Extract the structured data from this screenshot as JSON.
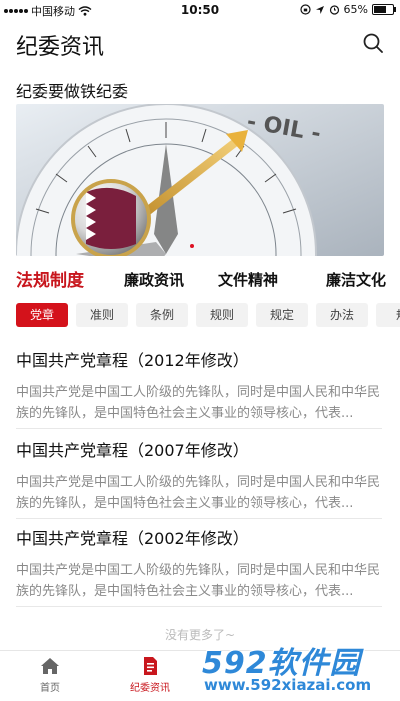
{
  "status_bar": {
    "carrier": "中国移动",
    "time": "10:50",
    "battery": "65%",
    "battery_level": 0.65
  },
  "header": {
    "title": "纪委资讯",
    "search_icon": "search-icon"
  },
  "section": {
    "title": "纪委要做铁纪委"
  },
  "categories": [
    {
      "label": "法规制度",
      "active": true
    },
    {
      "label": "廉政资讯",
      "active": false
    },
    {
      "label": "文件精神",
      "active": false
    },
    {
      "label": "廉洁文化",
      "active": false
    }
  ],
  "sub_tabs": [
    {
      "label": "党章",
      "active": true
    },
    {
      "label": "准则",
      "active": false
    },
    {
      "label": "条例",
      "active": false
    },
    {
      "label": "规则",
      "active": false
    },
    {
      "label": "规定",
      "active": false
    },
    {
      "label": "办法",
      "active": false
    },
    {
      "label": "规",
      "active": false
    }
  ],
  "articles": [
    {
      "title": "中国共产党章程（2012年修改）",
      "excerpt": "中国共产党是中国工人阶级的先锋队，同时是中国人民和中华民族的先锋队，是中国特色社会主义事业的领导核心，代表..."
    },
    {
      "title": "中国共产党章程（2007年修改）",
      "excerpt": "中国共产党是中国工人阶级的先锋队，同时是中国人民和中华民族的先锋队，是中国特色社会主义事业的领导核心，代表..."
    },
    {
      "title": "中国共产党章程（2002年修改）",
      "excerpt": "中国共产党是中国工人阶级的先锋队，同时是中国人民和中华民族的先锋队，是中国特色社会主义事业的领导核心，代表..."
    }
  ],
  "no_more": "没有更多了~",
  "tab_bar": [
    {
      "label": "首页",
      "icon": "home-icon",
      "active": false
    },
    {
      "label": "纪委资讯",
      "icon": "document-icon",
      "active": true
    }
  ],
  "watermark": {
    "main": "592软件园",
    "url": "www.592xiazai.com"
  },
  "colors": {
    "accent": "#c8161d",
    "watermark": "#2e88d8"
  }
}
